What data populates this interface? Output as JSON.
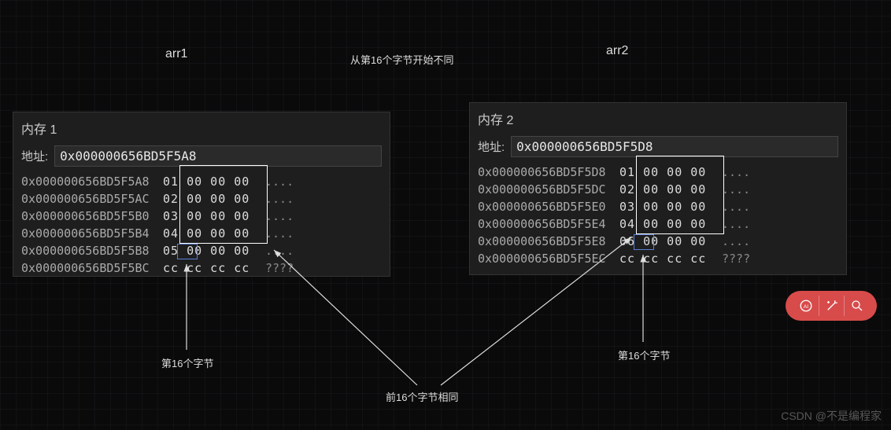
{
  "labels": {
    "arr1": "arr1",
    "arr2": "arr2",
    "diff_from_16": "从第16个字节开始不同",
    "byte16_left": "第16个字节",
    "byte16_right": "第16个字节",
    "first16_same": "前16个字节相同"
  },
  "panel1": {
    "title": "内存 1",
    "addr_label": "地址:",
    "addr_value": "0x000000656BD5F5A8",
    "rows": [
      {
        "addr": "0x000000656BD5F5A8",
        "bytes": "01 00 00 00",
        "ascii": "...."
      },
      {
        "addr": "0x000000656BD5F5AC",
        "bytes": "02 00 00 00",
        "ascii": "...."
      },
      {
        "addr": "0x000000656BD5F5B0",
        "bytes": "03 00 00 00",
        "ascii": "...."
      },
      {
        "addr": "0x000000656BD5F5B4",
        "bytes": "04 00 00 00",
        "ascii": "...."
      },
      {
        "addr": "0x000000656BD5F5B8",
        "bytes": "05 00 00 00",
        "ascii": "...."
      },
      {
        "addr": "0x000000656BD5F5BC",
        "bytes": "cc cc cc cc",
        "ascii": "????"
      }
    ]
  },
  "panel2": {
    "title": "内存 2",
    "addr_label": "地址:",
    "addr_value": "0x000000656BD5F5D8",
    "rows": [
      {
        "addr": "0x000000656BD5F5D8",
        "bytes": "01 00 00 00",
        "ascii": "...."
      },
      {
        "addr": "0x000000656BD5F5DC",
        "bytes": "02 00 00 00",
        "ascii": "...."
      },
      {
        "addr": "0x000000656BD5F5E0",
        "bytes": "03 00 00 00",
        "ascii": "...."
      },
      {
        "addr": "0x000000656BD5F5E4",
        "bytes": "04 00 00 00",
        "ascii": "...."
      },
      {
        "addr": "0x000000656BD5F5E8",
        "bytes": "06 00 00 00",
        "ascii": "...."
      },
      {
        "addr": "0x000000656BD5F5EC",
        "bytes": "cc cc cc cc",
        "ascii": "????"
      }
    ]
  },
  "watermark": "CSDN @不是编程家"
}
